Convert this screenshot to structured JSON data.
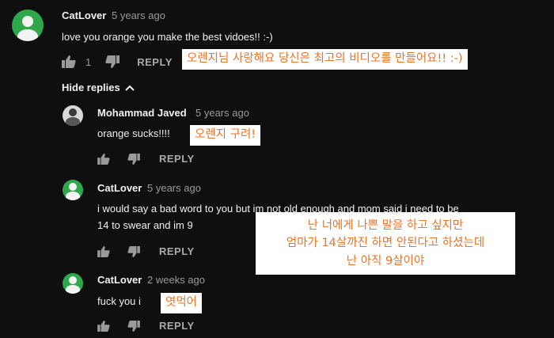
{
  "comments": [
    {
      "author": "CatLover",
      "time": "5 years ago",
      "text": "love you orange you make the best vidoes!! :-)",
      "like_count": "1",
      "reply_label": "REPLY",
      "translation": "오렌지님 사랑해요 당신은 최고의 비디오를 만들어요!! :-)"
    },
    {
      "author": "Mohammad Javed",
      "time": "5 years ago",
      "text": "orange sucks!!!!",
      "reply_label": "REPLY",
      "translation": "오렌지 구려!"
    },
    {
      "author": "CatLover",
      "time": "5 years ago",
      "text_line1": "i would say a bad word to you but im not old enough and mom said i need to be",
      "text_line2": "14 to swear and im 9",
      "reply_label": "REPLY",
      "translation_lines": [
        "난 너에게 나쁜 말을 하고 싶지만",
        "엄마가 14살까진 하면 안된다고 하셨는데",
        "난 아직 9살이야"
      ]
    },
    {
      "author": "CatLover",
      "time": "2 weeks ago",
      "text": "fuck you i",
      "reply_label": "REPLY",
      "translation": "엿먹어"
    }
  ],
  "hide_replies_label": "Hide replies",
  "icons": {
    "like": "thumbs-up-icon",
    "dislike": "thumbs-down-icon",
    "chevron": "chevron-up-icon"
  },
  "colors": {
    "background": "#0f0f0f",
    "avatar_green": "#2ea84a",
    "overlay_text": "#e8762a",
    "overlay_bg": "#ffffff"
  }
}
